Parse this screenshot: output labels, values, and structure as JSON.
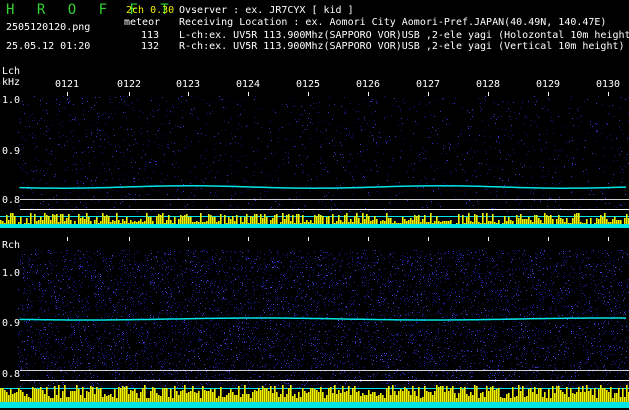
{
  "header": {
    "app_title": "H R O F F T",
    "version": "2ch 0.30",
    "filename": "2505120120.png",
    "datetime": "25.05.12 01:20",
    "meteor_label": "meteor",
    "lch_count": "113",
    "rch_count": "132",
    "observer": "Ovserver              : ex. JR7CYX [ kid ]",
    "location": "Receiving Location : ex. Aomori City Aomori-Pref.JAPAN(40.49N, 140.47E)",
    "lch_info": "L-ch:ex. UV5R 113.900Mhz(SAPPORO VOR)USB ,2-ele yagi (Holozontal 10m height)",
    "rch_info": "R-ch:ex. UV5R 113.900Mhz(SAPPORO VOR)USB ,2-ele yagi (Vertical 10m height)"
  },
  "time_ticks": [
    "0121",
    "0122",
    "0123",
    "0124",
    "0125",
    "0126",
    "0127",
    "0128",
    "0129",
    "0130"
  ],
  "lch": {
    "label": "Lch",
    "unit": "kHz",
    "y_ticks": [
      "1.0",
      "0.9",
      "0.8"
    ]
  },
  "rch": {
    "label": "Rch",
    "y_ticks": [
      "1.0",
      "0.9",
      "0.8"
    ]
  },
  "colors": {
    "background": "#000000",
    "noise": "#1a1a8c",
    "signal": "#00e6e6",
    "bars": "#f2f200",
    "logo": "#32d232"
  }
}
